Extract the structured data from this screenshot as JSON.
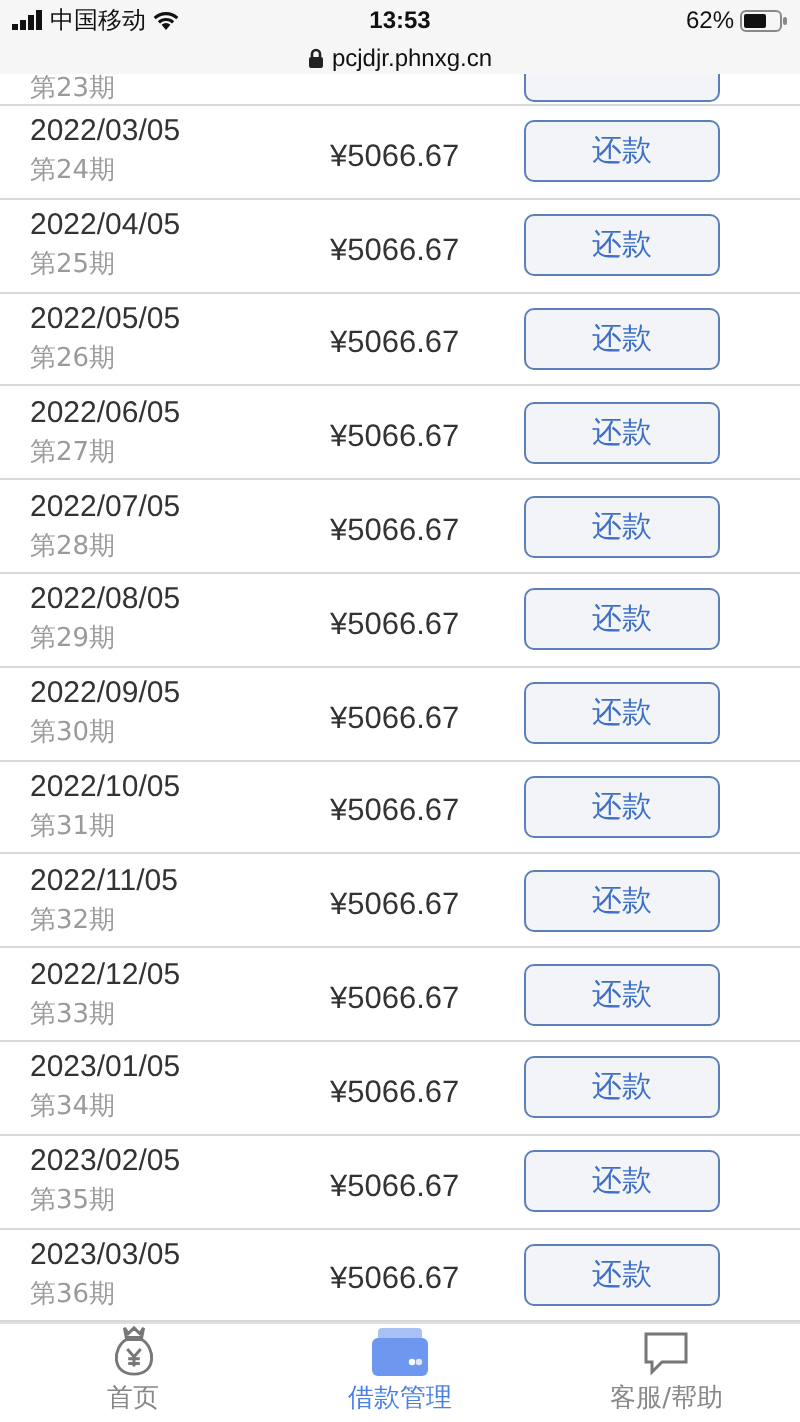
{
  "status_bar": {
    "carrier": "中国移动",
    "time": "13:53",
    "battery": "62%",
    "url": "pcjdjr.phnxg.cn"
  },
  "partial_row": {
    "period": "第23期"
  },
  "installments": [
    {
      "date": "2022/03/05",
      "period": "第24期",
      "amount": "¥5066.67",
      "action": "还款"
    },
    {
      "date": "2022/04/05",
      "period": "第25期",
      "amount": "¥5066.67",
      "action": "还款"
    },
    {
      "date": "2022/05/05",
      "period": "第26期",
      "amount": "¥5066.67",
      "action": "还款"
    },
    {
      "date": "2022/06/05",
      "period": "第27期",
      "amount": "¥5066.67",
      "action": "还款"
    },
    {
      "date": "2022/07/05",
      "period": "第28期",
      "amount": "¥5066.67",
      "action": "还款"
    },
    {
      "date": "2022/08/05",
      "period": "第29期",
      "amount": "¥5066.67",
      "action": "还款"
    },
    {
      "date": "2022/09/05",
      "period": "第30期",
      "amount": "¥5066.67",
      "action": "还款"
    },
    {
      "date": "2022/10/05",
      "period": "第31期",
      "amount": "¥5066.67",
      "action": "还款"
    },
    {
      "date": "2022/11/05",
      "period": "第32期",
      "amount": "¥5066.67",
      "action": "还款"
    },
    {
      "date": "2022/12/05",
      "period": "第33期",
      "amount": "¥5066.67",
      "action": "还款"
    },
    {
      "date": "2023/01/05",
      "period": "第34期",
      "amount": "¥5066.67",
      "action": "还款"
    },
    {
      "date": "2023/02/05",
      "period": "第35期",
      "amount": "¥5066.67",
      "action": "还款"
    },
    {
      "date": "2023/03/05",
      "period": "第36期",
      "amount": "¥5066.67",
      "action": "还款"
    }
  ],
  "tabs": [
    {
      "label": "首页",
      "kind": "home",
      "selected": false
    },
    {
      "label": "借款管理",
      "kind": "loans",
      "selected": true
    },
    {
      "label": "客服/帮助",
      "kind": "help",
      "selected": false
    }
  ]
}
